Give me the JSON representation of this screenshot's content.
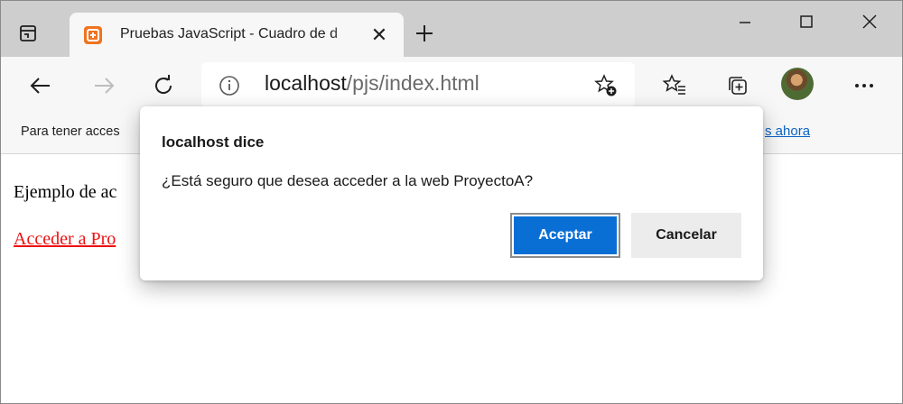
{
  "browser": {
    "tab": {
      "title": "Pruebas JavaScript - Cuadro de d",
      "close_glyph": "✕"
    },
    "new_tab_glyph": "+",
    "omnibox": {
      "host": "localhost",
      "path": "/pjs/index.html"
    },
    "favorites_bar": {
      "text": "Para tener acces",
      "link": "s ahora"
    },
    "colors": {
      "tabstrip": "#cecece",
      "toolbar": "#f7f7f7",
      "accent": "#0a6fd4",
      "link_red": "#ee1010"
    },
    "icons": [
      "tab-actions-icon",
      "app-favicon-icon",
      "close-icon",
      "plus-icon",
      "minimize-icon",
      "maximize-icon",
      "window-close-icon",
      "back-arrow-icon",
      "forward-arrow-icon",
      "refresh-icon",
      "info-icon",
      "add-favorite-icon",
      "favorites-icon",
      "collections-icon",
      "more-icon"
    ]
  },
  "page": {
    "text": "Ejemplo de ac",
    "link": "Acceder a Pro"
  },
  "dialog": {
    "title": "localhost dice",
    "message": "¿Está seguro que desea acceder a la web ProyectoA?",
    "accept_label": "Aceptar",
    "cancel_label": "Cancelar"
  }
}
